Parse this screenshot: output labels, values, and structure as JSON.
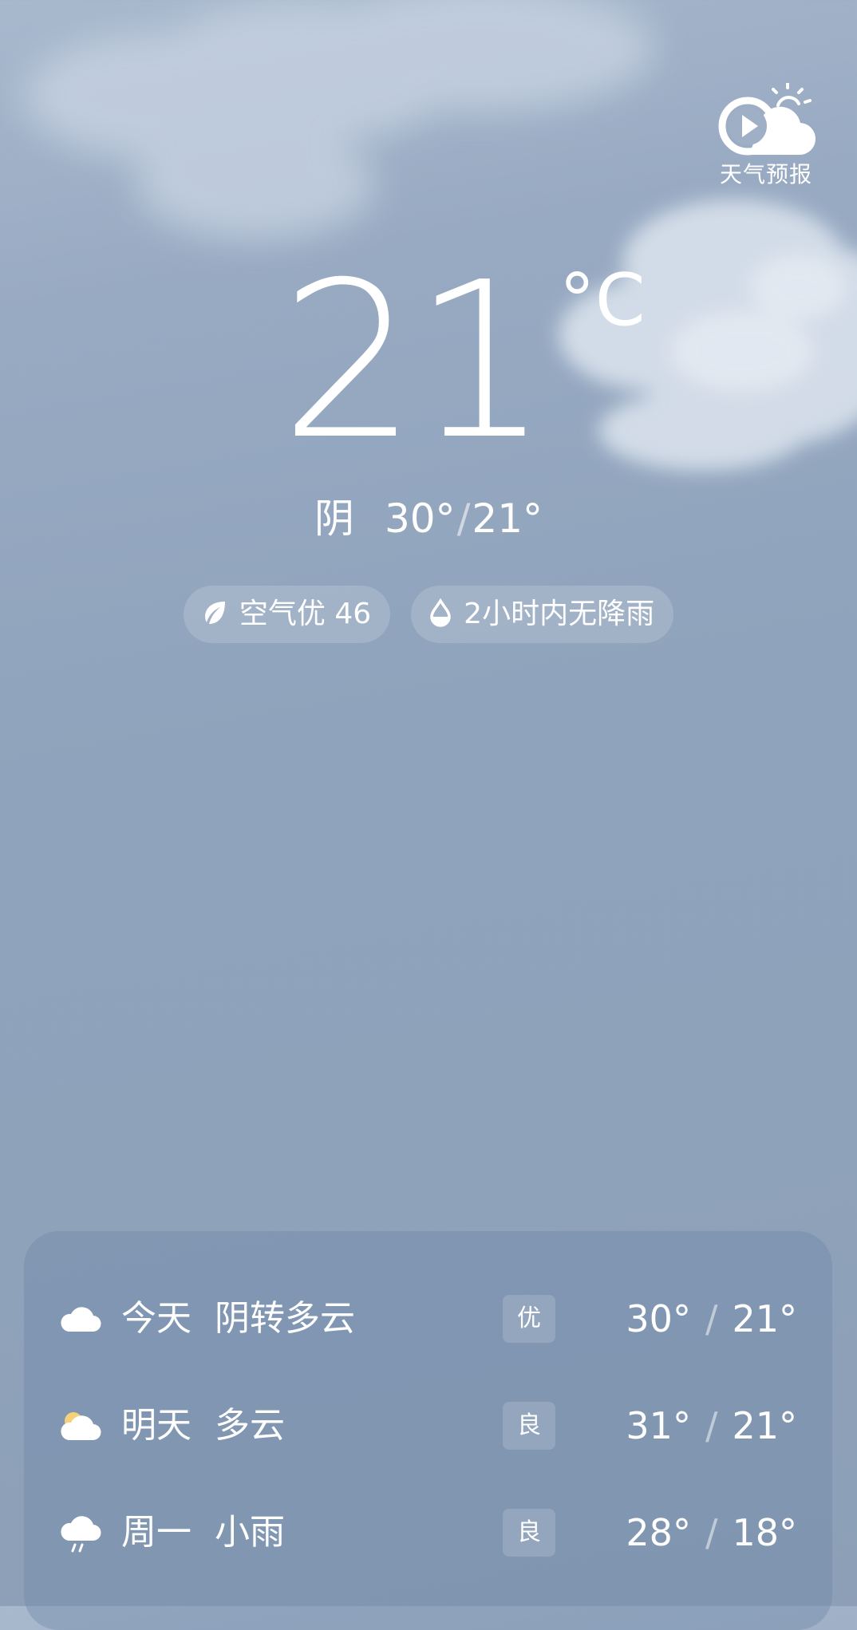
{
  "header": {
    "video_weather_label": "天气预报"
  },
  "current": {
    "temperature": "21",
    "unit": "°C",
    "condition": "阴",
    "high": "30°",
    "low": "21°",
    "separator": "/"
  },
  "pills": {
    "air_quality": "空气优 46",
    "rain_forecast": "2小时内无降雨"
  },
  "forecast": [
    {
      "day": "今天",
      "condition": "阴转多云",
      "aqi": "优",
      "high": "30°",
      "low": "21°",
      "icon": "cloud-icon"
    },
    {
      "day": "明天",
      "condition": "多云",
      "aqi": "良",
      "high": "31°",
      "low": "21°",
      "icon": "partly-cloudy-icon"
    },
    {
      "day": "周一",
      "condition": "小雨",
      "aqi": "良",
      "high": "28°",
      "low": "18°",
      "icon": "light-rain-icon"
    }
  ],
  "colors": {
    "sky_top": "#a8b8cd",
    "sky_bottom": "#8c9fb6",
    "sun": "#f5d27a"
  }
}
